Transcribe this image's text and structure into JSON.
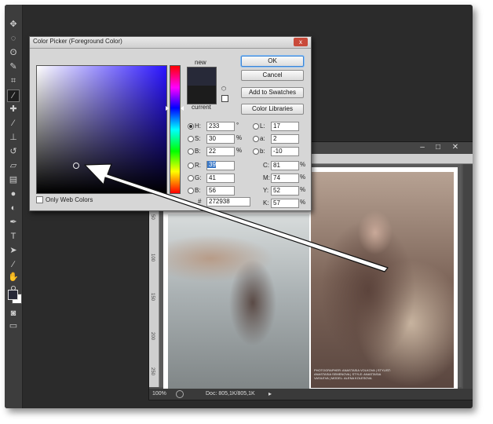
{
  "dialog": {
    "title": "Color Picker (Foreground Color)",
    "close_label": "x",
    "new_label": "new",
    "current_label": "current",
    "new_color": "#272938",
    "current_color": "#1c1c1c",
    "buttons": {
      "ok": "OK",
      "cancel": "Cancel",
      "add_to_swatches": "Add to Swatches",
      "color_libraries": "Color Libraries"
    },
    "hsb": [
      {
        "label": "H:",
        "value": "233",
        "unit": "°",
        "checked": true
      },
      {
        "label": "S:",
        "value": "30",
        "unit": "%",
        "checked": false
      },
      {
        "label": "B:",
        "value": "22",
        "unit": "%",
        "checked": false
      }
    ],
    "rgb": [
      {
        "label": "R:",
        "value": "39",
        "selected": true
      },
      {
        "label": "G:",
        "value": "41"
      },
      {
        "label": "B:",
        "value": "56"
      }
    ],
    "lab": [
      {
        "label": "L:",
        "value": "17"
      },
      {
        "label": "a:",
        "value": "2"
      },
      {
        "label": "b:",
        "value": "-10"
      }
    ],
    "cmyk": [
      {
        "label": "C:",
        "value": "81",
        "unit": "%"
      },
      {
        "label": "M:",
        "value": "74",
        "unit": "%"
      },
      {
        "label": "Y:",
        "value": "52",
        "unit": "%"
      },
      {
        "label": "K:",
        "value": "57",
        "unit": "%"
      }
    ],
    "hex_label": "#",
    "hex_value": "272938",
    "only_web_colors": "Only Web Colors"
  },
  "document": {
    "zoom": "100%",
    "doc_info": "Doc: 805,1K/805,1K",
    "ruler_marks": [
      "0",
      "50",
      "100",
      "150",
      "200",
      "250"
    ],
    "caption": "PHOTOGRAPHER: ANASTASIA VOLKOVA | STYLIST: ANASTASIA SEMENOVA | STYLE: ANASTASIA VASILEVA | MODEL: ALENA KOLESOVA"
  },
  "tools": [
    "move-tool",
    "marquee-tool",
    "lasso-tool",
    "quick-select-tool",
    "crop-tool",
    "eyedropper-tool",
    "healing-tool",
    "brush-tool",
    "stamp-tool",
    "history-brush-tool",
    "eraser-tool",
    "gradient-tool",
    "blur-tool",
    "dodge-tool",
    "pen-tool",
    "type-tool",
    "path-select-tool",
    "shape-tool",
    "hand-tool",
    "zoom-tool"
  ],
  "colors": {
    "foreground": "#272938",
    "background": "#ffffff",
    "app_bg": "#2b2b2b"
  }
}
